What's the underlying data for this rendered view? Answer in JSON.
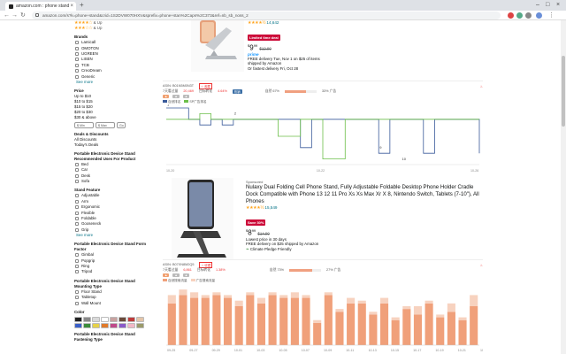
{
  "browser": {
    "tab_title": "amazon.com : phone stand",
    "url": "amazon.com/s?k=phone+stand&crid=1S2DVW070HXV&sprefix=phone+stan%2Caps%2C373&ref=nb_sb_noss_2"
  },
  "sidebar": {
    "top_ratings": [
      {
        "stars": "★★★★☆",
        "label": "& Up"
      },
      {
        "stars": "★★★☆☆",
        "label": "& Up"
      }
    ],
    "brands": {
      "heading": "Brands",
      "items": [
        "Lamicall",
        "OMOTON",
        "UGREEN",
        "LISEN",
        "TCB",
        "CreoDream",
        "Generic"
      ],
      "see_more": "See more"
    },
    "price": {
      "heading": "Price",
      "items": [
        "Up to $10",
        "$10 to $15",
        "$15 to $20",
        "$20 to $30",
        "$30 & above"
      ],
      "min_placeholder": "$ Min",
      "max_placeholder": "$ Max",
      "go": "Go"
    },
    "deals": {
      "heading": "Deals & Discounts",
      "items": [
        "All Discounts",
        "Today's Deals"
      ]
    },
    "uses": {
      "heading": "Portable Electronic Device Stand Recommended Uses For Product",
      "items": [
        "Bed",
        "Car",
        "Desk",
        "Sofa"
      ]
    },
    "features": {
      "heading": "Stand Feature",
      "items": [
        "Adjustable",
        "Arm",
        "Ergonomic",
        "Flexible",
        "Foldable",
        "Gooseneck",
        "Grip"
      ],
      "see_more": "See more"
    },
    "form": {
      "heading": "Portable Electronic Device Stand Form Factor",
      "items": [
        "Gimbal",
        "Popgrip",
        "Ring",
        "Tripod"
      ]
    },
    "mounting": {
      "heading": "Portable Electronic Device Stand Mounting Type",
      "items": [
        "Floor Stand",
        "Tabletop",
        "Wall Mount"
      ]
    },
    "color_heading": "Color",
    "colors": [
      "#222222",
      "#8a8a8a",
      "#d9d9d9",
      "#ffffff",
      "#c8a2a0",
      "#6b4a3a",
      "#bf3a3a",
      "#e3c4a8",
      "#3a5fc8",
      "#3c8c3c",
      "#e6d24a",
      "#e07a2a",
      "#c04a8a",
      "#8a5ac8",
      "#f2b8c6",
      "#9a9a6a"
    ],
    "fastening_heading": "Portable Electronic Device Stand Fastening Type"
  },
  "product1": {
    "rating_count": "14,642",
    "price_whole": "9",
    "price_fraction": "99",
    "was_price": "$12.99",
    "deal_badge": "Limited time deal",
    "prime": "prime",
    "delivery": "FREE delivery Tue, Nov 1 on $25 of items",
    "shipped_by": "shipped by Amazon",
    "fastest": "Or fastest delivery Fri, Oct 28"
  },
  "keepa1": {
    "asin": "ASIN: B01N5M0N3T",
    "row1_label": "7天看过量",
    "row1_value": "20,469",
    "row1_sub": "目标转化",
    "row1_pct": "4.64%",
    "row1_tag": "热销",
    "row1_right": "自然 67%",
    "row1_right2": "33% 广告",
    "legend": [
      "自然排名",
      "SP广告排名"
    ],
    "xlabels": [
      "10-20",
      "10-22",
      "10-26"
    ],
    "point_labels": [
      "1",
      "2",
      "9",
      "10"
    ]
  },
  "product2": {
    "sponsored": "Sponsored",
    "title": "Nulaxy Dual Folding Cell Phone Stand, Fully Adjustable Foldable Desktop Phone Holder Cradle Dock Compatible with Phone 13 12 11 Pro Xs Xs Max Xr X 8, Nintendo Switch, Tablets (7-10\"), All Phones",
    "rating_count": "15,549",
    "deal_badge": "Save 30%",
    "price_whole": "8",
    "price_fraction": "99",
    "was_price": "$14.99",
    "lowest": "Lowest price in 30 days",
    "delivery": "FREE delivery on $25 shipped by Amazon",
    "climate": "Climate Pledge Friendly"
  },
  "keepa2": {
    "asin": "ASIN: B07XN8M2Q5",
    "row1_label": "7天看过量",
    "row1_value": "6,861",
    "row1_sub": "目标转化",
    "row1_pct": "1.38%",
    "row1_right": "自然 73%",
    "row1_right2": "27% 广告",
    "legend": [
      "自然搜索流量",
      "广告搜索流量"
    ],
    "xlabels": [
      "09-25",
      "09-27",
      "09-29",
      "10-01",
      "10-03",
      "10-05",
      "10-07",
      "10-09",
      "10-11",
      "10-13",
      "10-15",
      "10-17",
      "10-19",
      "10-21",
      "10-23"
    ]
  },
  "chart_data": [
    {
      "type": "line",
      "series": [
        {
          "name": "自然排名",
          "color": "#3a5a9a",
          "points": [
            [
              0,
              1
            ],
            [
              1,
              1
            ],
            [
              2,
              3
            ],
            [
              3,
              4
            ],
            [
              4,
              3
            ],
            [
              5,
              4
            ],
            [
              6,
              3
            ],
            [
              7,
              3
            ],
            [
              8,
              3
            ],
            [
              9,
              3
            ],
            [
              10,
              3
            ],
            [
              11,
              3
            ],
            [
              12,
              8
            ],
            [
              13,
              3
            ],
            [
              14,
              3
            ],
            [
              15,
              3
            ],
            [
              16,
              3
            ],
            [
              17,
              3
            ],
            [
              18,
              3
            ],
            [
              19,
              9
            ],
            [
              20,
              3
            ],
            [
              21,
              3
            ],
            [
              22,
              3
            ],
            [
              23,
              9
            ],
            [
              24,
              3
            ],
            [
              25,
              3
            ],
            [
              26,
              3
            ],
            [
              27,
              3
            ],
            [
              28,
              9
            ]
          ]
        },
        {
          "name": "SP广告排名",
          "color": "#6cbf4a",
          "points": [
            [
              0,
              3
            ],
            [
              1,
              3
            ],
            [
              2,
              3
            ],
            [
              3,
              2
            ],
            [
              4,
              3
            ],
            [
              5,
              3
            ],
            [
              6,
              3
            ],
            [
              7,
              3
            ],
            [
              8,
              3
            ],
            [
              9,
              3
            ],
            [
              10,
              6
            ],
            [
              11,
              6
            ],
            [
              12,
              3
            ],
            [
              13,
              3
            ],
            [
              14,
              10
            ],
            [
              15,
              10
            ],
            [
              16,
              3
            ],
            [
              17,
              3
            ],
            [
              18,
              3
            ],
            [
              19,
              3
            ],
            [
              20,
              3
            ],
            [
              21,
              3
            ],
            [
              22,
              3
            ],
            [
              23,
              3
            ],
            [
              24,
              3
            ],
            [
              25,
              3
            ],
            [
              26,
              3
            ],
            [
              27,
              3
            ],
            [
              28,
              3
            ]
          ]
        }
      ],
      "xlabels": [
        "10-20",
        "10-22",
        "10-26"
      ]
    },
    {
      "type": "bar",
      "categories": [
        "09-25",
        "",
        "09-27",
        "",
        "09-29",
        "",
        "10-01",
        "",
        "10-03",
        "",
        "10-05",
        "",
        "10-07",
        "",
        "10-09",
        "",
        "10-11",
        "",
        "10-13",
        "",
        "10-15",
        "",
        "10-17",
        "",
        "10-19",
        "",
        "10-21",
        "",
        "10-23",
        ""
      ],
      "series": [
        {
          "name": "自然搜索流量",
          "color": "#f0a07a",
          "values": [
            30,
            36,
            34,
            34,
            36,
            34,
            28,
            36,
            30,
            36,
            34,
            34,
            34,
            16,
            36,
            24,
            30,
            30,
            22,
            30,
            18,
            26,
            22,
            30,
            20,
            24,
            18,
            28
          ]
        },
        {
          "name": "广告搜索流量",
          "color": "#f7d2bf",
          "values": [
            6,
            4,
            4,
            2,
            2,
            2,
            4,
            2,
            4,
            2,
            2,
            4,
            2,
            2,
            2,
            2,
            4,
            2,
            2,
            4,
            2,
            2,
            6,
            2,
            2,
            6,
            2,
            8
          ]
        }
      ]
    }
  ]
}
